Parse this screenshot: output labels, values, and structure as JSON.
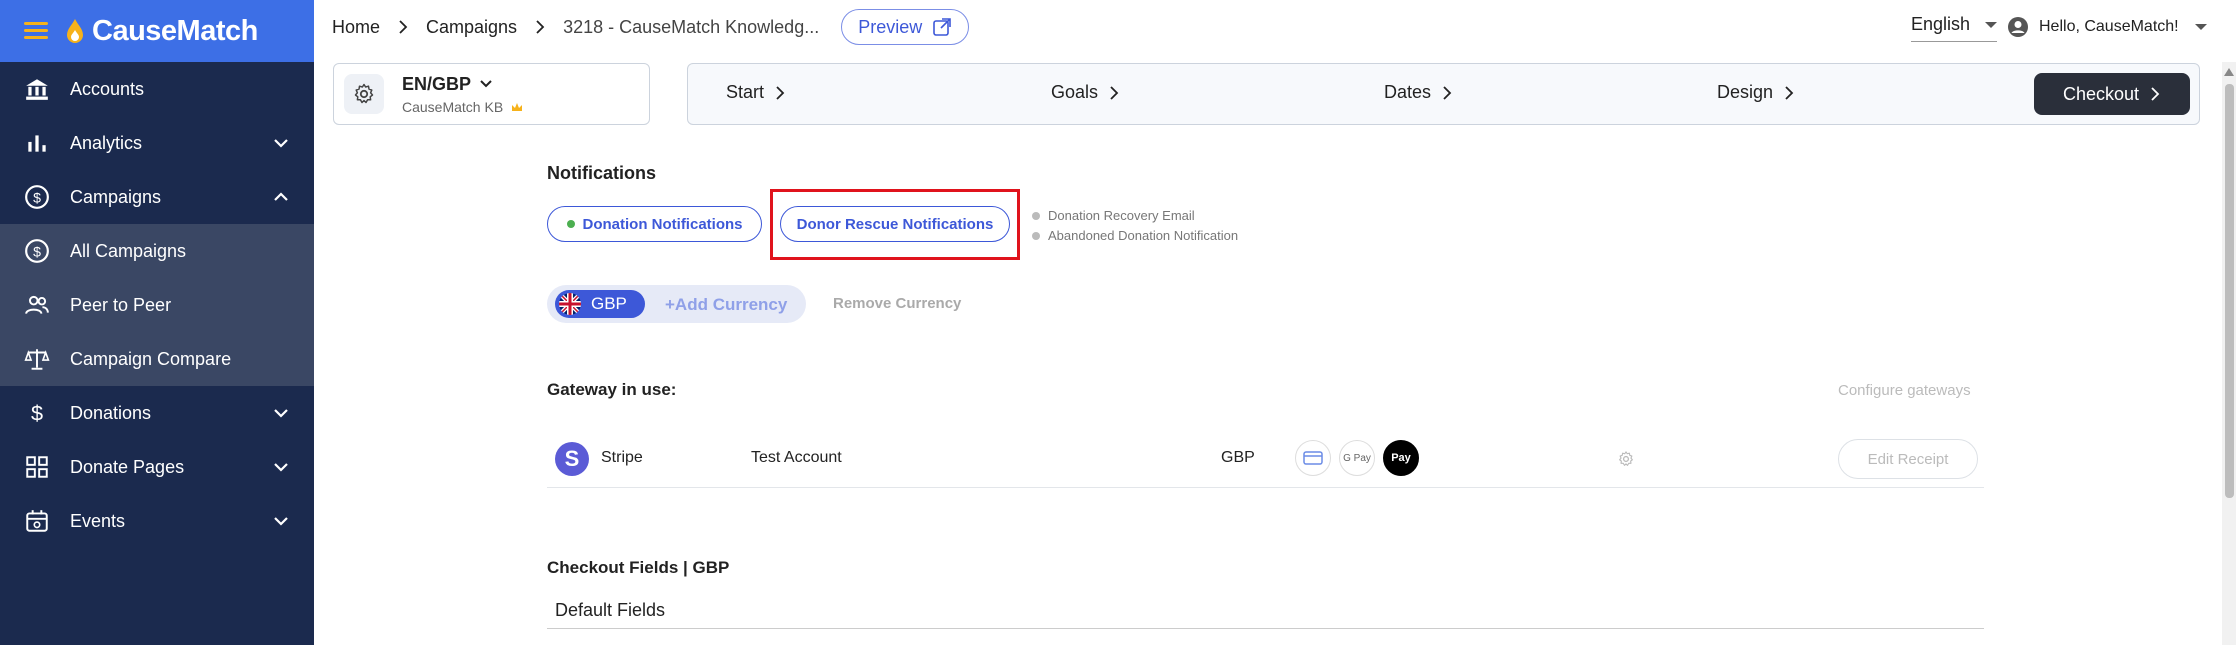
{
  "brand": {
    "name": "CauseMatch"
  },
  "sidebar": {
    "items": [
      {
        "label": "Accounts",
        "icon": "bank-icon"
      },
      {
        "label": "Analytics",
        "icon": "bar-chart-icon"
      },
      {
        "label": "Campaigns",
        "icon": "dollar-circle-icon"
      },
      {
        "label": "All Campaigns",
        "icon": "dollar-circle-icon"
      },
      {
        "label": "Peer to Peer",
        "icon": "people-icon"
      },
      {
        "label": "Campaign Compare",
        "icon": "scale-icon"
      },
      {
        "label": "Donations",
        "icon": "dollar-icon"
      },
      {
        "label": "Donate Pages",
        "icon": "grid-icon"
      },
      {
        "label": "Events",
        "icon": "calendar-icon"
      }
    ]
  },
  "breadcrumb": {
    "home": "Home",
    "campaigns": "Campaigns",
    "current": "3218  -  CauseMatch Knowledg..."
  },
  "preview_label": "Preview",
  "header": {
    "language": "English",
    "greeting": "Hello, CauseMatch!"
  },
  "locale": {
    "code": "EN/GBP",
    "name": "CauseMatch KB"
  },
  "steps": {
    "start": "Start",
    "goals": "Goals",
    "dates": "Dates",
    "design": "Design",
    "checkout": "Checkout"
  },
  "notifications": {
    "title": "Notifications",
    "donation_button": "Donation Notifications",
    "rescue_button": "Donor Rescue Notifications",
    "legend": [
      "Donation Recovery Email",
      "Abandoned Donation Notification"
    ]
  },
  "currency": {
    "selected": "GBP",
    "add": "+Add Currency",
    "remove": "Remove Currency"
  },
  "gateway": {
    "title": "Gateway in use:",
    "configure": "Configure gateways",
    "name": "Stripe",
    "account": "Test Account",
    "currency": "GBP",
    "gpay": "G Pay",
    "applepay": "Pay",
    "edit_receipt": "Edit Receipt"
  },
  "checkout_fields": {
    "title": "Checkout Fields | GBP",
    "default_fields": "Default Fields"
  },
  "colors": {
    "sidebar": "#1b2a4e",
    "brand": "#3d6fe6",
    "accent": "#3d58d8",
    "highlight": "#e0131c"
  }
}
